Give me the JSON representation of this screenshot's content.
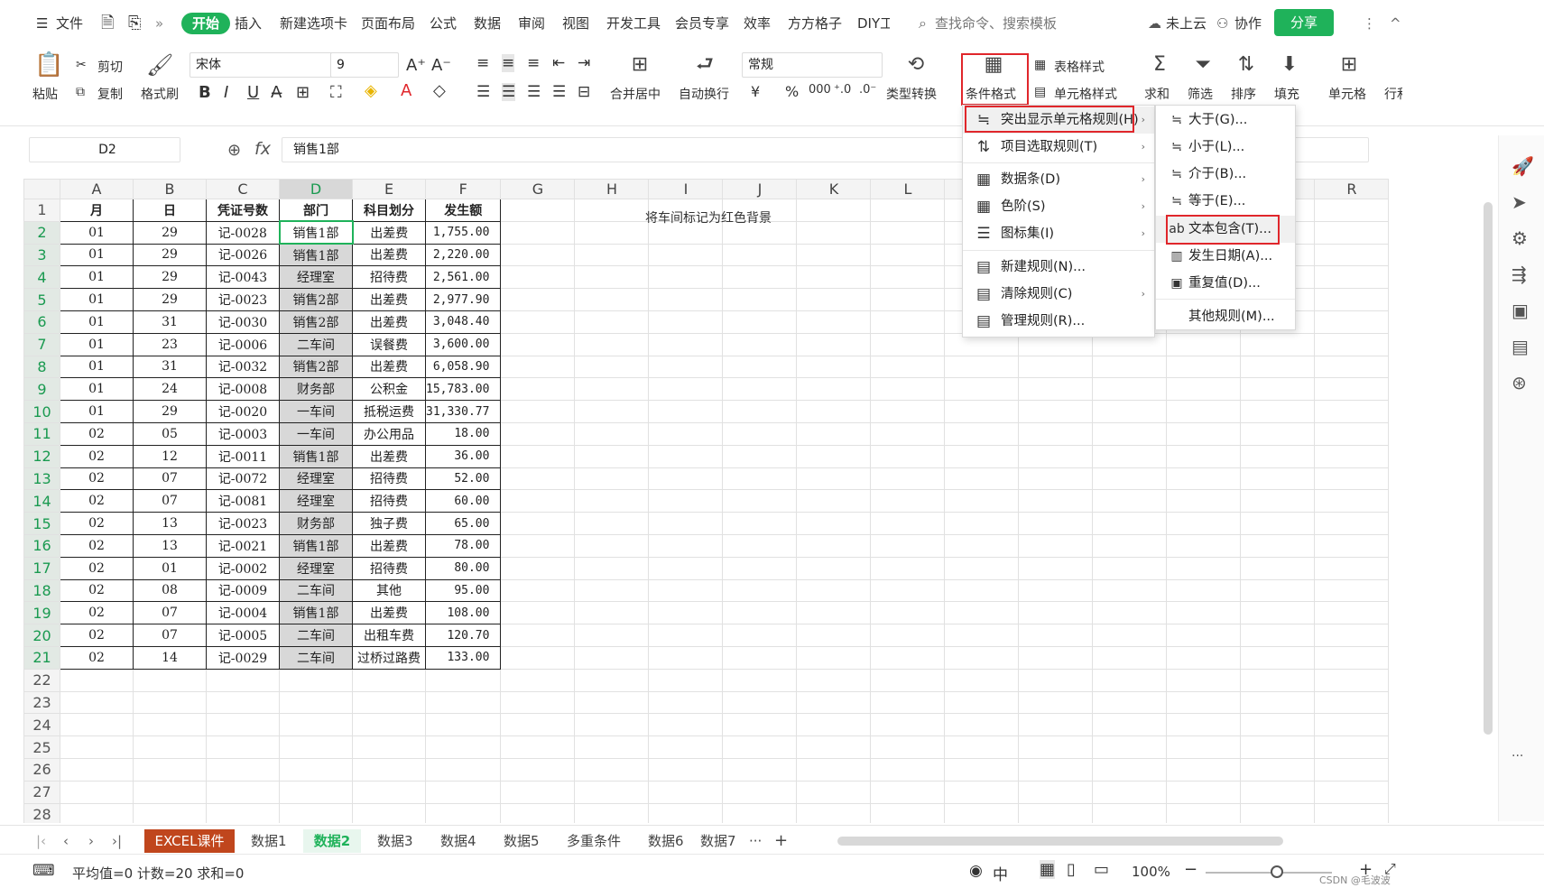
{
  "menubar": {
    "file": "文件",
    "more": "»",
    "items": [
      "开始",
      "插入",
      "新建选项卡",
      "页面布局",
      "公式",
      "数据",
      "审阅",
      "视图",
      "开发工具",
      "会员专享",
      "效率",
      "方方格子",
      "DIY工"
    ],
    "search": "查找命令、搜索模板",
    "cloud": "未上云",
    "collab": "协作",
    "share": "分享",
    "more_dots": "⋮",
    "collapse": "^"
  },
  "ribbon": {
    "paste": "粘贴",
    "cut": "剪切",
    "copy": "复制",
    "format_painter": "格式刷",
    "font_name": "宋体",
    "font_size": "9",
    "bold": "B",
    "italic": "I",
    "underline": "U",
    "number_format": "常规",
    "merge_center": "合并居中",
    "wrap": "自动换行",
    "type_convert": "类型转换",
    "cond_format": "条件格式",
    "table_style": "表格样式",
    "cell_style": "单元格样式",
    "sum": "求和",
    "filter": "筛选",
    "sort": "排序",
    "fill": "填充",
    "cell": "单元格",
    "row_col": "行和",
    "currency": "¥",
    "percent": "%",
    "thousands": "000"
  },
  "formula_bar": {
    "name_box": "D2",
    "fx": "fx",
    "value": "销售1部"
  },
  "columns": [
    "A",
    "B",
    "C",
    "D",
    "E",
    "F",
    "G",
    "H",
    "I",
    "J",
    "K",
    "L",
    "",
    "",
    "",
    "",
    "",
    "R"
  ],
  "row_numbers": [
    "1",
    "2",
    "3",
    "4",
    "5",
    "6",
    "7",
    "8",
    "9",
    "10",
    "11",
    "12",
    "13",
    "14",
    "15",
    "16",
    "17",
    "18",
    "19",
    "20",
    "21",
    "22",
    "23",
    "24",
    "25",
    "26",
    "27",
    "28"
  ],
  "table": {
    "headers": [
      "月",
      "日",
      "凭证号数",
      "部门",
      "科目划分",
      "发生额"
    ],
    "rows": [
      [
        "01",
        "29",
        "记-0028",
        "销售1部",
        "出差费",
        "1,755.00"
      ],
      [
        "01",
        "29",
        "记-0026",
        "销售1部",
        "出差费",
        "2,220.00"
      ],
      [
        "01",
        "29",
        "记-0043",
        "经理室",
        "招待费",
        "2,561.00"
      ],
      [
        "01",
        "29",
        "记-0023",
        "销售2部",
        "出差费",
        "2,977.90"
      ],
      [
        "01",
        "31",
        "记-0030",
        "销售2部",
        "出差费",
        "3,048.40"
      ],
      [
        "01",
        "23",
        "记-0006",
        "二车间",
        "误餐费",
        "3,600.00"
      ],
      [
        "01",
        "31",
        "记-0032",
        "销售2部",
        "出差费",
        "6,058.90"
      ],
      [
        "01",
        "24",
        "记-0008",
        "财务部",
        "公积金",
        "15,783.00"
      ],
      [
        "01",
        "29",
        "记-0020",
        "一车间",
        "抵税运费",
        "31,330.77"
      ],
      [
        "02",
        "05",
        "记-0003",
        "一车间",
        "办公用品",
        "18.00"
      ],
      [
        "02",
        "12",
        "记-0011",
        "销售1部",
        "出差费",
        "36.00"
      ],
      [
        "02",
        "07",
        "记-0072",
        "经理室",
        "招待费",
        "52.00"
      ],
      [
        "02",
        "07",
        "记-0081",
        "经理室",
        "招待费",
        "60.00"
      ],
      [
        "02",
        "13",
        "记-0023",
        "财务部",
        "独子费",
        "65.00"
      ],
      [
        "02",
        "13",
        "记-0021",
        "销售1部",
        "出差费",
        "78.00"
      ],
      [
        "02",
        "01",
        "记-0002",
        "经理室",
        "招待费",
        "80.00"
      ],
      [
        "02",
        "08",
        "记-0009",
        "二车间",
        "其他",
        "95.00"
      ],
      [
        "02",
        "07",
        "记-0004",
        "销售1部",
        "出差费",
        "108.00"
      ],
      [
        "02",
        "07",
        "记-0005",
        "二车间",
        "出租车费",
        "120.70"
      ],
      [
        "02",
        "14",
        "记-0029",
        "二车间",
        "过桥过路费",
        "133.00"
      ]
    ]
  },
  "note": "将车间标记为红色背景",
  "menu1": [
    {
      "label": "突出显示单元格规则(H)",
      "icon": "≒",
      "arrow": "›"
    },
    {
      "label": "项目选取规则(T)",
      "icon": "⇅",
      "arrow": "›"
    },
    {
      "label": "数据条(D)",
      "icon": "▦",
      "arrow": "›"
    },
    {
      "label": "色阶(S)",
      "icon": "▦",
      "arrow": "›"
    },
    {
      "label": "图标集(I)",
      "icon": "☰",
      "arrow": "›"
    },
    {
      "label": "新建规则(N)...",
      "icon": "▤",
      "arrow": ""
    },
    {
      "label": "清除规则(C)",
      "icon": "▤",
      "arrow": "›"
    },
    {
      "label": "管理规则(R)...",
      "icon": "▤",
      "arrow": ""
    }
  ],
  "menu2": [
    {
      "label": "大于(G)...",
      "icon": "≒"
    },
    {
      "label": "小于(L)...",
      "icon": "≒"
    },
    {
      "label": "介于(B)...",
      "icon": "≒"
    },
    {
      "label": "等于(E)...",
      "icon": "≒"
    },
    {
      "label": "文本包含(T)...",
      "icon": "ab"
    },
    {
      "label": "发生日期(A)...",
      "icon": "▥"
    },
    {
      "label": "重复值(D)...",
      "icon": "▣"
    },
    {
      "label": "其他规则(M)...",
      "icon": ""
    }
  ],
  "tabs": [
    "EXCEL课件",
    "数据1",
    "数据2",
    "数据3",
    "数据4",
    "数据5",
    "多重条件",
    "数据6",
    "数据7"
  ],
  "tabs_more": "···",
  "tabs_add": "+",
  "status": {
    "summary": "平均值=0  计数=20  求和=0",
    "zoom": "100%",
    "watermark": "CSDN @毛波波"
  },
  "colors": {
    "accent": "#1fb25a",
    "highlight_box": "#e0262b",
    "selected_cell": "#d8d8d8"
  }
}
